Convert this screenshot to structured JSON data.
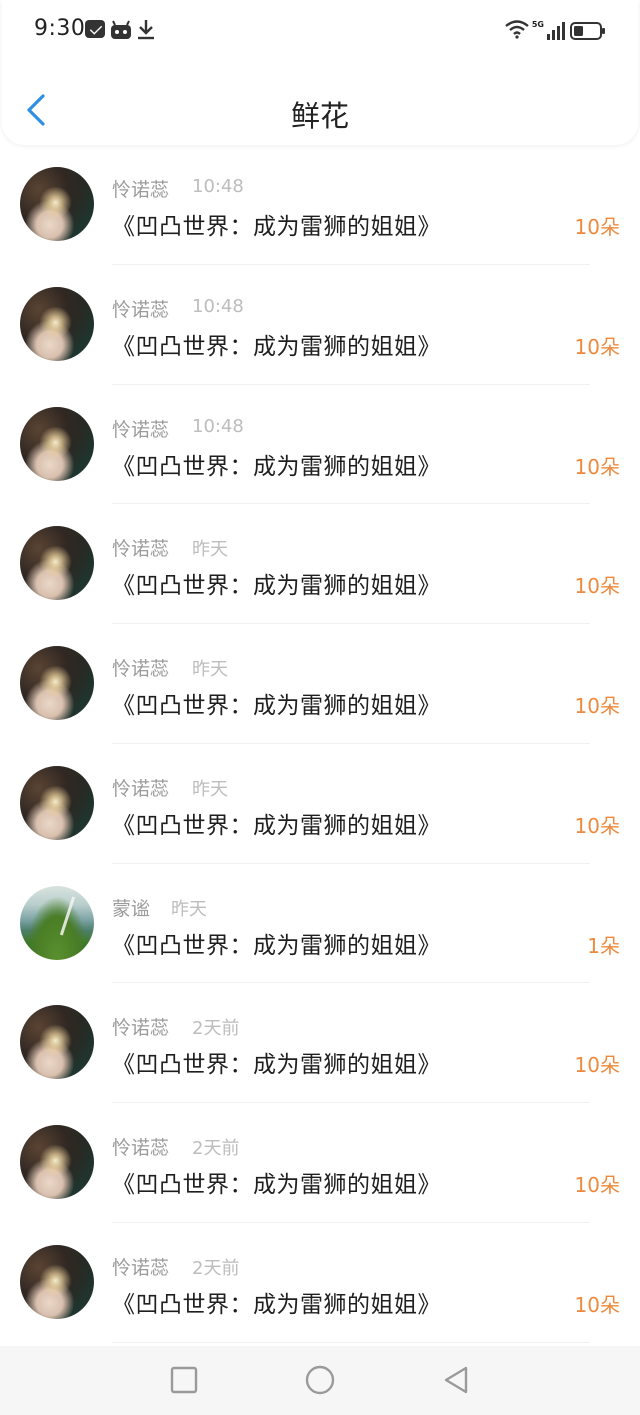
{
  "status_bar": {
    "time": "9:30",
    "network": "5G",
    "icons": [
      "message-icon",
      "robot-icon",
      "download-icon",
      "wifi-icon",
      "signal-icon",
      "battery-icon"
    ]
  },
  "header": {
    "title": "鲜花",
    "back_icon": "chevron-left-icon"
  },
  "colors": {
    "accent_blue": "#2d8fe6",
    "count_orange": "#ee8a3e",
    "meta_gray": "#9b9b9b",
    "time_gray": "#bdbdbd"
  },
  "items": [
    {
      "user": "怜诺蕊",
      "time": "10:48",
      "title": "《凹凸世界：成为雷狮的姐姐》",
      "count": "10朵",
      "avatar": "avatar-a"
    },
    {
      "user": "怜诺蕊",
      "time": "10:48",
      "title": "《凹凸世界：成为雷狮的姐姐》",
      "count": "10朵",
      "avatar": "avatar-a"
    },
    {
      "user": "怜诺蕊",
      "time": "10:48",
      "title": "《凹凸世界：成为雷狮的姐姐》",
      "count": "10朵",
      "avatar": "avatar-a"
    },
    {
      "user": "怜诺蕊",
      "time": "昨天",
      "title": "《凹凸世界：成为雷狮的姐姐》",
      "count": "10朵",
      "avatar": "avatar-a"
    },
    {
      "user": "怜诺蕊",
      "time": "昨天",
      "title": "《凹凸世界：成为雷狮的姐姐》",
      "count": "10朵",
      "avatar": "avatar-a"
    },
    {
      "user": "怜诺蕊",
      "time": "昨天",
      "title": "《凹凸世界：成为雷狮的姐姐》",
      "count": "10朵",
      "avatar": "avatar-a"
    },
    {
      "user": "蒙谧",
      "time": "昨天",
      "title": "《凹凸世界：成为雷狮的姐姐》",
      "count": "1朵",
      "avatar": "avatar-b"
    },
    {
      "user": "怜诺蕊",
      "time": "2天前",
      "title": "《凹凸世界：成为雷狮的姐姐》",
      "count": "10朵",
      "avatar": "avatar-a"
    },
    {
      "user": "怜诺蕊",
      "time": "2天前",
      "title": "《凹凸世界：成为雷狮的姐姐》",
      "count": "10朵",
      "avatar": "avatar-a"
    },
    {
      "user": "怜诺蕊",
      "time": "2天前",
      "title": "《凹凸世界：成为雷狮的姐姐》",
      "count": "10朵",
      "avatar": "avatar-a"
    }
  ],
  "nav_bar": {
    "buttons": [
      "recents-square-icon",
      "home-circle-icon",
      "back-triangle-icon"
    ]
  }
}
